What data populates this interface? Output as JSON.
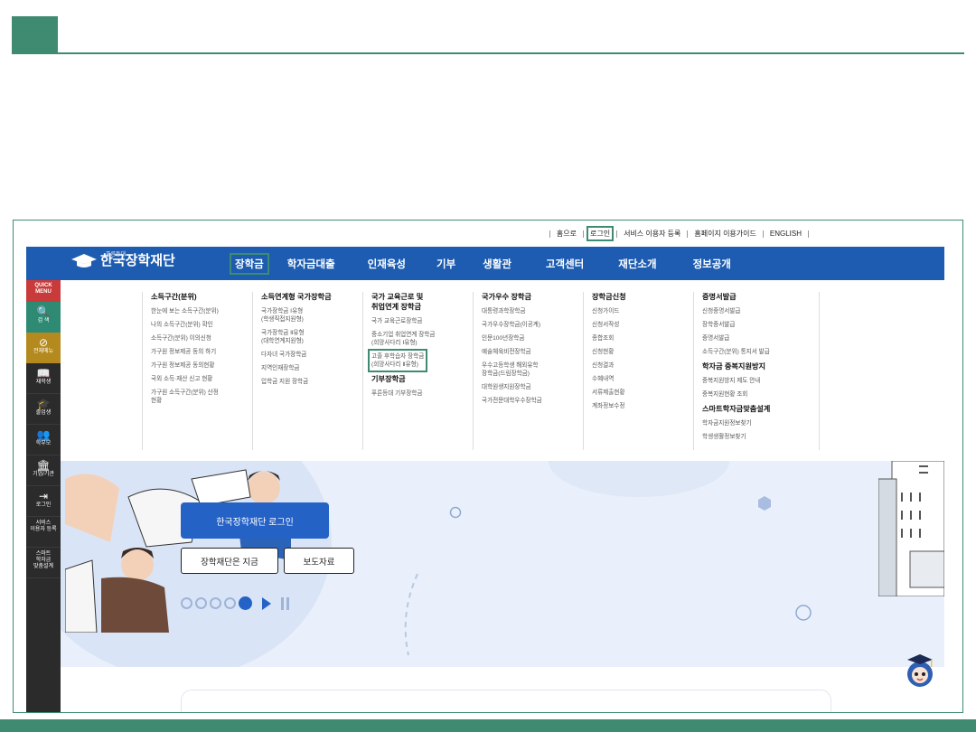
{
  "utility_links": [
    {
      "label": "홈으로",
      "highlighted": false
    },
    {
      "label": "로그인",
      "highlighted": true
    },
    {
      "label": "서비스 이용자 등록",
      "highlighted": false
    },
    {
      "label": "홈페이지 이용가이드",
      "highlighted": false
    },
    {
      "label": "ENGLISH",
      "highlighted": false
    }
  ],
  "logo": {
    "text": "한국장학재단",
    "sub": "푸른등대"
  },
  "nav": [
    {
      "label": "장학금",
      "active": true
    },
    {
      "label": "학자금대출"
    },
    {
      "label": "인재육성"
    },
    {
      "label": "기부"
    },
    {
      "label": "생활관"
    },
    {
      "label": "고객센터"
    },
    {
      "label": "재단소개"
    },
    {
      "label": "정보공개"
    }
  ],
  "sidebar": [
    {
      "label": "QUICK\nMENU",
      "icon": "quick-menu"
    },
    {
      "label": "검 색",
      "icon": "search-icon"
    },
    {
      "label": "전체메뉴",
      "icon": "compass-icon"
    },
    {
      "label": "재학생",
      "icon": "book-icon"
    },
    {
      "label": "졸업생",
      "icon": "graduation-cap-icon"
    },
    {
      "label": "학부모",
      "icon": "parents-icon"
    },
    {
      "label": "기업/기관",
      "icon": "institution-icon"
    },
    {
      "label": "로그인",
      "icon": "login-icon"
    },
    {
      "label": "서비스\n이용자 등록",
      "icon": ""
    },
    {
      "label": "스마트\n학자금\n맞춤설계",
      "icon": ""
    }
  ],
  "megamenu": {
    "col1": {
      "h": "소득구간(분위)",
      "items": [
        "한눈에 보는 소득구간(분위)",
        "나의 소득구간(분위) 확인",
        "소득구간(분위) 이의신청",
        "가구원 정보제공 동의 하기",
        "가구원 정보제공 동의현황",
        "국외 소득·재산 신고 현황",
        "가구원 소득구간(분위) 산정\n현황"
      ]
    },
    "col2": {
      "h": "소득연계형 국가장학금",
      "items": [
        "국가장학금 Ⅰ유형\n(학생직접지원형)",
        "국가장학금 Ⅱ유형\n(대학연계지원형)",
        "다자녀 국가장학금",
        "지역인재장학금",
        "입학금 지원 장학금"
      ]
    },
    "col3": {
      "h": "국가 교육근로 및\n취업연계 장학금",
      "items": [
        "국가 교육근로장학금",
        "중소기업 취업연계 장학금\n(희망사다리 Ⅰ유형)"
      ],
      "hl_item": "고졸 후학습자 장학금\n(희망사다리 Ⅱ유형)",
      "h2": "기부장학금",
      "items2": [
        "푸른등대 기부장학금"
      ]
    },
    "col4": {
      "h": "국가우수 장학금",
      "items": [
        "대통령과학장학금",
        "국가우수장학금(이공계)",
        "인문100년장학금",
        "예술체육비전장학금",
        "우수고등학생 해외유학\n장학금(드림장학금)",
        "대학원생지원장학금",
        "국가전문대학우수장학금"
      ]
    },
    "col5": {
      "h": "장학금신청",
      "items": [
        "신청가이드",
        "신청서작성",
        "종합조회",
        "신청현황",
        "신청결과",
        "수혜내역",
        "서류제출현황",
        "계좌정보수정"
      ]
    },
    "col6": {
      "h": "증명서발급",
      "items": [
        "신청증명서발급",
        "장학증서발급",
        "증명서발급",
        "소득구간(분위) 통지서 발급"
      ],
      "h2": "학자금 중복지원방지",
      "items2": [
        "중복지원방지 제도 안내",
        "중복지원현황 조회"
      ],
      "h3": "스마트학자금맞춤설계",
      "items3": [
        "학자금지원정보찾기",
        "학생생활정보찾기"
      ]
    }
  },
  "hero": {
    "login_button": "한국장학재단 로그인",
    "btn1": "장학재단은 지금",
    "btn2": "보도자료"
  },
  "colors": {
    "accent_green": "#3e8b72",
    "nav_blue": "#1d5cb0",
    "button_blue": "#2462c6"
  }
}
